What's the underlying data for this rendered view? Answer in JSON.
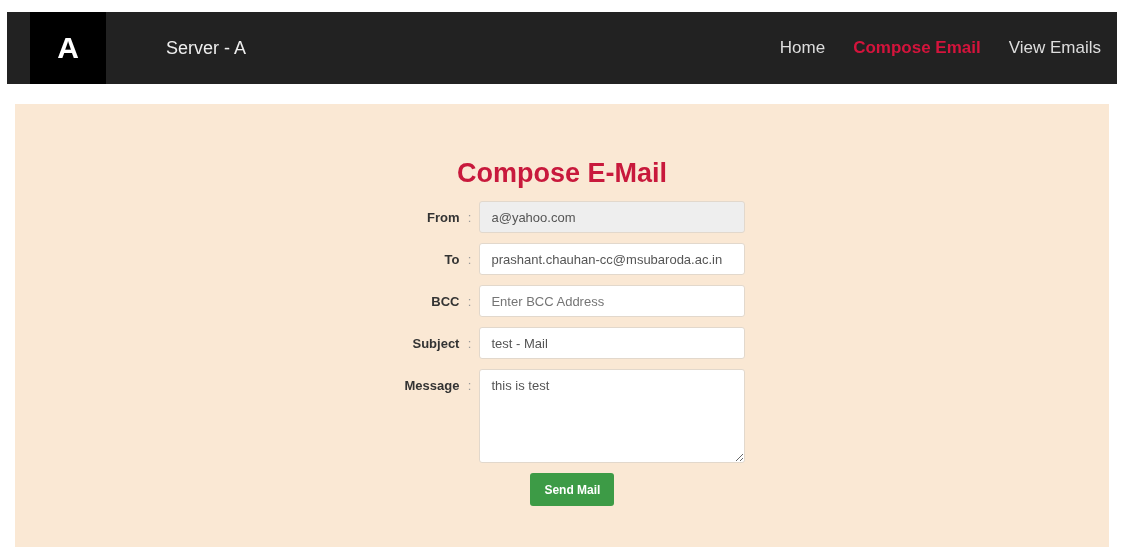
{
  "navbar": {
    "logo": "A",
    "brand": "Server - A",
    "links": [
      {
        "label": "Home",
        "selected": false
      },
      {
        "label": "Compose Email",
        "selected": true
      },
      {
        "label": "View Emails",
        "selected": false
      }
    ]
  },
  "form": {
    "title": "Compose E-Mail",
    "fields": [
      {
        "kind": "input",
        "label": "From",
        "separator": ":",
        "value": "a@yahoo.com",
        "disabled": true
      },
      {
        "kind": "input",
        "label": "To",
        "separator": ":",
        "value": "prashant.chauhan-cc@msubaroda.ac.in",
        "disabled": false
      },
      {
        "kind": "input",
        "label": "BCC",
        "separator": ":",
        "placeholder": "Enter BCC Address",
        "disabled": false
      },
      {
        "kind": "input",
        "label": "Subject",
        "separator": ":",
        "value": "test - Mail",
        "disabled": false
      },
      {
        "kind": "textarea",
        "label": "Message",
        "separator": ":",
        "value": "this is test",
        "disabled": false
      }
    ],
    "submit": "Send Mail"
  }
}
